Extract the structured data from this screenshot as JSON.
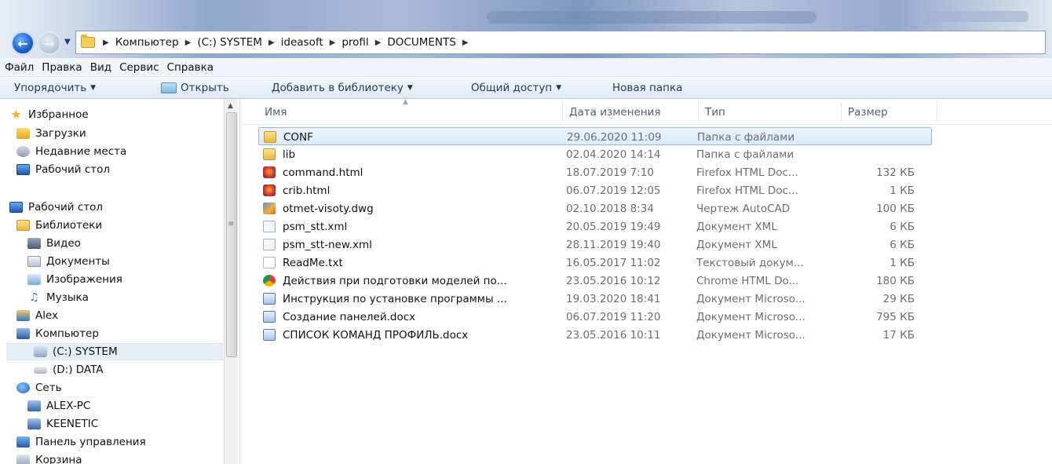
{
  "address": {
    "crumbs": [
      "Компьютер",
      "(C:) SYSTEM",
      "ideasoft",
      "profil",
      "DOCUMENTS"
    ]
  },
  "menu": [
    "Файл",
    "Правка",
    "Вид",
    "Сервис",
    "Справка"
  ],
  "toolbar": {
    "organize": "Упорядочить",
    "open": "Открыть",
    "add_to_library": "Добавить в библиотеку",
    "share": "Общий доступ",
    "new_folder": "Новая папка"
  },
  "nav": [
    {
      "label": "Избранное",
      "icon": "star-icon"
    },
    {
      "label": "Загрузки",
      "icon": "downloads-icon"
    },
    {
      "label": "Недавние места",
      "icon": "recent-places-icon"
    },
    {
      "label": "Рабочий стол",
      "icon": "desktop-icon"
    },
    {
      "label": "Рабочий стол",
      "icon": "desktop-icon"
    },
    {
      "label": "Библиотеки",
      "icon": "library-icon"
    },
    {
      "label": "Видео",
      "icon": "video-icon"
    },
    {
      "label": "Документы",
      "icon": "documents-icon"
    },
    {
      "label": "Изображения",
      "icon": "images-icon"
    },
    {
      "label": "Музыка",
      "icon": "music-icon"
    },
    {
      "label": "Alex",
      "icon": "user-folder-icon"
    },
    {
      "label": "Компьютер",
      "icon": "computer-icon"
    },
    {
      "label": "(C:) SYSTEM",
      "icon": "drive-icon"
    },
    {
      "label": "(D:) DATA",
      "icon": "drive-icon"
    },
    {
      "label": "Сеть",
      "icon": "network-icon"
    },
    {
      "label": "ALEX-PC",
      "icon": "pc-icon"
    },
    {
      "label": "KEENETIC",
      "icon": "pc-icon"
    },
    {
      "label": "Панель управления",
      "icon": "control-panel-icon"
    },
    {
      "label": "Корзина",
      "icon": "recycle-bin-icon"
    }
  ],
  "columns": {
    "name": "Имя",
    "date": "Дата изменения",
    "type": "Тип",
    "size": "Размер"
  },
  "files": [
    {
      "name": "CONF",
      "date": "29.06.2020 11:09",
      "type": "Папка с файлами",
      "size": "",
      "icon": "folder-icon"
    },
    {
      "name": "lib",
      "date": "02.04.2020 14:14",
      "type": "Папка с файлами",
      "size": "",
      "icon": "folder-icon"
    },
    {
      "name": "command.html",
      "date": "18.07.2019 7:10",
      "type": "Firefox HTML Doc...",
      "size": "132 КБ",
      "icon": "firefox-html-icon"
    },
    {
      "name": "crib.html",
      "date": "06.07.2019 12:05",
      "type": "Firefox HTML Doc...",
      "size": "1 КБ",
      "icon": "firefox-html-icon"
    },
    {
      "name": "otmet-visoty.dwg",
      "date": "02.10.2018 8:34",
      "type": "Чертеж AutoCAD",
      "size": "100 КБ",
      "icon": "dwg-icon"
    },
    {
      "name": "psm_stt.xml",
      "date": "20.05.2019 19:49",
      "type": "Документ XML",
      "size": "6 КБ",
      "icon": "xml-icon"
    },
    {
      "name": "psm_stt-new.xml",
      "date": "28.11.2019 19:40",
      "type": "Документ XML",
      "size": "6 КБ",
      "icon": "xml-icon"
    },
    {
      "name": "ReadMe.txt",
      "date": "16.05.2017 11:02",
      "type": "Текстовый докум...",
      "size": "1 КБ",
      "icon": "text-file-icon"
    },
    {
      "name": "Действия при подготовки моделей по...",
      "date": "23.05.2016 10:12",
      "type": "Chrome HTML Do...",
      "size": "180 КБ",
      "icon": "chrome-html-icon"
    },
    {
      "name": "Инструкция по установке программы ...",
      "date": "19.03.2020 18:41",
      "type": "Документ Microso...",
      "size": "29 КБ",
      "icon": "word-doc-icon"
    },
    {
      "name": "Создание панелей.docx",
      "date": "06.07.2019 11:20",
      "type": "Документ Microso...",
      "size": "795 КБ",
      "icon": "word-doc-icon"
    },
    {
      "name": "СПИСОК КОМАНД ПРОФИЛЬ.docx",
      "date": "23.05.2016 10:11",
      "type": "Документ Microso...",
      "size": "17 КБ",
      "icon": "word-doc-icon"
    }
  ],
  "colors": {
    "selection_border": "#8ebbe9",
    "selection_fill": "#dbeafb",
    "toolbar_text": "#1e395b"
  }
}
